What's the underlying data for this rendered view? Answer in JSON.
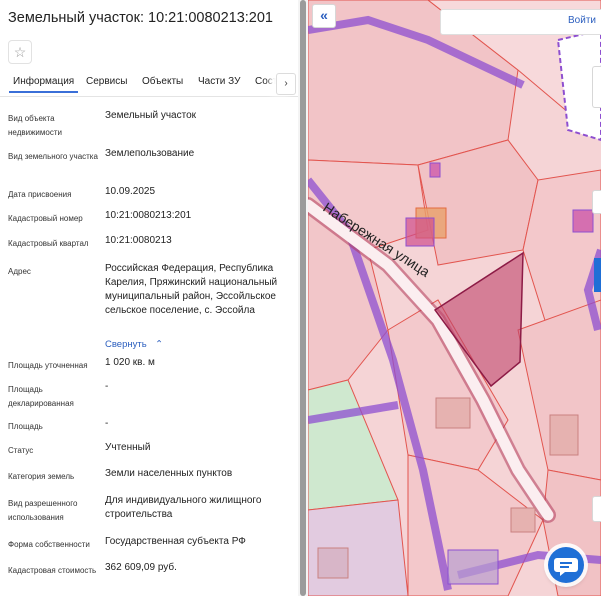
{
  "header": {
    "title": "Земельный участок: 10:21:0080213:201",
    "favorite_icon": "star-icon"
  },
  "tabs": [
    {
      "label": "Информация",
      "active": true
    },
    {
      "label": "Сервисы",
      "active": false
    },
    {
      "label": "Объекты",
      "active": false
    },
    {
      "label": "Части ЗУ",
      "active": false
    },
    {
      "label": "Сост",
      "active": false
    }
  ],
  "tabs_next_icon": "›",
  "details": [
    {
      "label": "Вид объекта недвижимости",
      "value": "Земельный участок"
    },
    {
      "label": "Вид земельного участка",
      "value": "Землепользование"
    },
    {
      "label": "Дата присвоения",
      "value": "10.09.2025"
    },
    {
      "label": "Кадастровый номер",
      "value": "10:21:0080213:201"
    },
    {
      "label": "Кадастровый квартал",
      "value": "10:21:0080213"
    },
    {
      "label": "Адрес",
      "value": "Российская Федерация, Республика Карелия, Пряжинский национальный муниципальный район, Эссойльское сельское поселение, с. Эссойла"
    },
    {
      "label": "Площадь уточненная",
      "value": "1 020 кв. м"
    },
    {
      "label": "Площадь декларированная",
      "value": "-"
    },
    {
      "label": "Площадь",
      "value": "-"
    },
    {
      "label": "Статус",
      "value": "Учтенный"
    },
    {
      "label": "Категория земель",
      "value": "Земли населенных пунктов"
    },
    {
      "label": "Вид разрешенного использования",
      "value": "Для индивидуального жилищного строительства"
    },
    {
      "label": "Форма собственности",
      "value": "Государственная субъекта РФ"
    },
    {
      "label": "Кадастровая стоимость",
      "value": "362 609,09 руб."
    }
  ],
  "collapse_link": "Свернуть",
  "collapse_link_icon": "chevron-up-icon",
  "map": {
    "street_label": "Набережная улица",
    "collapse_panel_icon": "«",
    "login_label": "Войти",
    "chat_icon": "chat-bubble-icon"
  },
  "colors": {
    "accent": "#2c5fbf",
    "parcel_fill": "#f3c6c9",
    "parcel_stroke": "#e2554f",
    "zone_purple": "#8e4fd0",
    "selected_parcel": "#c0446b"
  }
}
